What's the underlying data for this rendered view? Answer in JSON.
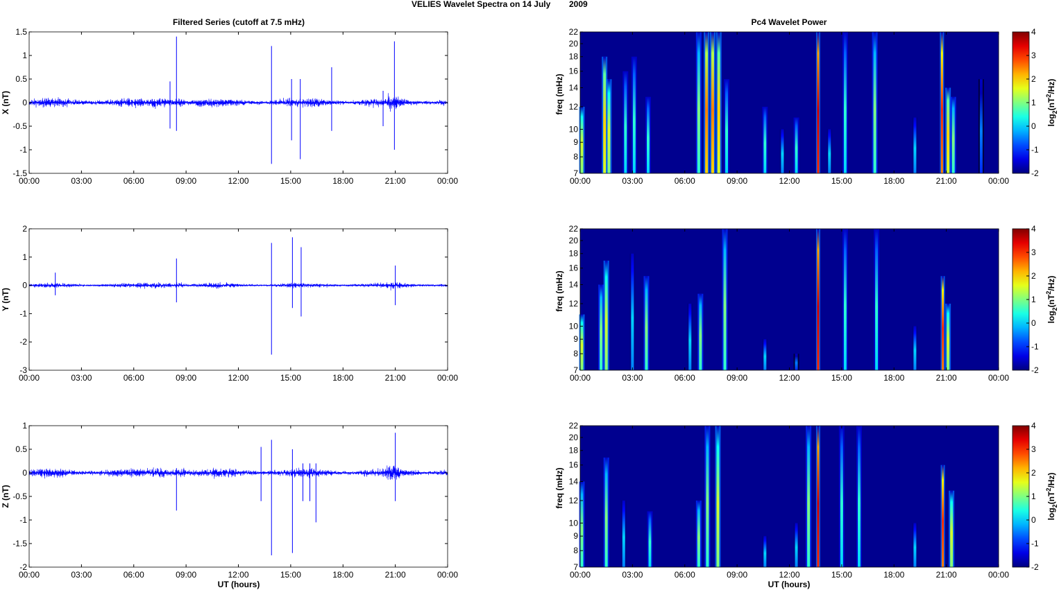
{
  "title": "VELIES Wavelet Spectra on 14 July",
  "year": "2009",
  "left_title": "Filtered Series (cutoff at 7.5 mHz)",
  "right_title": "Pc4 Wavelet Power",
  "xlabel": "UT (hours)",
  "freq_label": "freq (mHz)",
  "colorbar_label": "log2(nT2/Hz)",
  "colors": {
    "trace": "#0000ff",
    "background_power": "#00008f"
  },
  "chart_data": [
    {
      "type": "line",
      "name": "X",
      "ylabel": "X (nT)",
      "ylim": [
        -1.5,
        1.5
      ],
      "yticks": [
        "-1.5",
        "-1",
        "-0.5",
        "0",
        "0.5",
        "1",
        "1.5"
      ],
      "ytick_values": [
        -1.5,
        -1,
        -0.5,
        0,
        0.5,
        1,
        1.5
      ],
      "xticks": [
        "00:00",
        "03:00",
        "06:00",
        "09:00",
        "12:00",
        "15:00",
        "18:00",
        "21:00",
        "00:00"
      ],
      "xlim_hours": [
        0,
        24
      ],
      "noise_amplitude_nT": 0.15,
      "spikes": [
        {
          "t": 8.08,
          "max": 0.45,
          "min": -0.55
        },
        {
          "t": 8.45,
          "max": 1.4,
          "min": -0.6
        },
        {
          "t": 13.9,
          "max": 1.2,
          "min": -1.3
        },
        {
          "t": 15.05,
          "max": 0.5,
          "min": -0.8
        },
        {
          "t": 15.55,
          "max": 0.5,
          "min": -1.2
        },
        {
          "t": 17.35,
          "max": 0.75,
          "min": -0.6
        },
        {
          "t": 20.3,
          "max": 0.25,
          "min": -0.5
        },
        {
          "t": 20.95,
          "max": 1.3,
          "min": -1.0
        }
      ]
    },
    {
      "type": "line",
      "name": "Y",
      "ylabel": "Y (nT)",
      "ylim": [
        -3,
        2
      ],
      "yticks": [
        "-3",
        "-2",
        "-1",
        "0",
        "1",
        "2"
      ],
      "ytick_values": [
        -3,
        -2,
        -1,
        0,
        1,
        2
      ],
      "xticks": [
        "00:00",
        "03:00",
        "06:00",
        "09:00",
        "12:00",
        "15:00",
        "18:00",
        "21:00",
        "00:00"
      ],
      "xlim_hours": [
        0,
        24
      ],
      "noise_amplitude_nT": 0.14,
      "spikes": [
        {
          "t": 1.5,
          "max": 0.45,
          "min": -0.35
        },
        {
          "t": 8.45,
          "max": 0.95,
          "min": -0.6
        },
        {
          "t": 13.9,
          "max": 1.5,
          "min": -2.45
        },
        {
          "t": 15.1,
          "max": 1.7,
          "min": -0.8
        },
        {
          "t": 15.6,
          "max": 1.35,
          "min": -1.1
        },
        {
          "t": 21.0,
          "max": 0.7,
          "min": -0.7
        }
      ]
    },
    {
      "type": "line",
      "name": "Z",
      "ylabel": "Z (nT)",
      "ylim": [
        -2,
        1
      ],
      "yticks": [
        "-2",
        "-1.5",
        "-1",
        "-0.5",
        "0",
        "0.5",
        "1"
      ],
      "ytick_values": [
        -2,
        -1.5,
        -1,
        -0.5,
        0,
        0.5,
        1
      ],
      "xticks": [
        "00:00",
        "03:00",
        "06:00",
        "09:00",
        "12:00",
        "15:00",
        "18:00",
        "21:00",
        "00:00"
      ],
      "xlim_hours": [
        0,
        24
      ],
      "noise_amplitude_nT": 0.15,
      "spikes": [
        {
          "t": 8.45,
          "max": 0.1,
          "min": -0.8
        },
        {
          "t": 13.3,
          "max": 0.55,
          "min": -0.6
        },
        {
          "t": 13.9,
          "max": 0.7,
          "min": -1.75
        },
        {
          "t": 15.1,
          "max": 0.5,
          "min": -1.7
        },
        {
          "t": 15.7,
          "max": 0.2,
          "min": -0.6
        },
        {
          "t": 16.1,
          "max": 0.2,
          "min": -0.6
        },
        {
          "t": 16.45,
          "max": 0.2,
          "min": -1.05
        },
        {
          "t": 21.0,
          "max": 0.85,
          "min": -0.6
        }
      ]
    },
    {
      "type": "heatmap",
      "name": "X power",
      "ylabel": "freq (mHz)",
      "yscale": "log",
      "ylim": [
        7,
        22
      ],
      "yticks": [
        "7",
        "8",
        "9",
        "10",
        "12",
        "14",
        "16",
        "18",
        "20",
        "22"
      ],
      "ytick_values": [
        7,
        8,
        9,
        10,
        12,
        14,
        16,
        18,
        20,
        22
      ],
      "xticks": [
        "00:00",
        "03:00",
        "06:00",
        "09:00",
        "12:00",
        "15:00",
        "18:00",
        "21:00",
        "00:00"
      ],
      "clim": [
        -2,
        4
      ],
      "cticks": [
        "-2",
        "-1",
        "0",
        "1",
        "2",
        "3",
        "4"
      ],
      "bursts": [
        [
          0.1,
          12,
          1.5
        ],
        [
          1.4,
          18,
          2
        ],
        [
          1.65,
          15,
          1.5
        ],
        [
          2.6,
          16,
          0.5
        ],
        [
          3.1,
          18,
          0.5
        ],
        [
          3.9,
          13,
          0.5
        ],
        [
          6.8,
          22,
          1
        ],
        [
          7.25,
          22,
          2.5
        ],
        [
          7.6,
          22,
          2.5
        ],
        [
          7.95,
          22,
          2
        ],
        [
          8.4,
          15,
          0.5
        ],
        [
          10.6,
          12,
          0.5
        ],
        [
          11.6,
          10,
          0
        ],
        [
          12.4,
          11,
          0.5
        ],
        [
          13.65,
          22,
          3.5
        ],
        [
          14.3,
          10,
          0
        ],
        [
          15.2,
          22,
          0.5
        ],
        [
          16.9,
          22,
          1
        ],
        [
          19.2,
          11,
          0
        ],
        [
          20.75,
          22,
          3
        ],
        [
          21.1,
          14,
          2
        ],
        [
          21.4,
          13,
          1
        ],
        [
          23.0,
          15,
          -0.5
        ]
      ]
    },
    {
      "type": "heatmap",
      "name": "Y power",
      "ylabel": "freq (mHz)",
      "yscale": "log",
      "ylim": [
        7,
        22
      ],
      "yticks": [
        "7",
        "8",
        "9",
        "10",
        "12",
        "14",
        "16",
        "18",
        "20",
        "22"
      ],
      "ytick_values": [
        7,
        8,
        9,
        10,
        12,
        14,
        16,
        18,
        20,
        22
      ],
      "xticks": [
        "00:00",
        "03:00",
        "06:00",
        "09:00",
        "12:00",
        "15:00",
        "18:00",
        "21:00",
        "00:00"
      ],
      "clim": [
        -2,
        4
      ],
      "cticks": [
        "-2",
        "-1",
        "0",
        "1",
        "2",
        "3",
        "4"
      ],
      "bursts": [
        [
          0.1,
          11,
          1.5
        ],
        [
          1.2,
          14,
          1
        ],
        [
          1.5,
          17,
          1.5
        ],
        [
          3.0,
          18,
          0
        ],
        [
          3.8,
          15,
          1
        ],
        [
          6.3,
          12,
          0
        ],
        [
          6.9,
          13,
          1
        ],
        [
          8.3,
          22,
          1
        ],
        [
          10.6,
          9,
          0
        ],
        [
          12.4,
          8,
          -0.5
        ],
        [
          13.65,
          22,
          3.5
        ],
        [
          15.2,
          22,
          0.5
        ],
        [
          17.0,
          22,
          0.5
        ],
        [
          19.2,
          10,
          0
        ],
        [
          20.8,
          15,
          3
        ],
        [
          21.1,
          12,
          1.5
        ]
      ]
    },
    {
      "type": "heatmap",
      "name": "Z power",
      "ylabel": "freq (mHz)",
      "yscale": "log",
      "ylim": [
        7,
        22
      ],
      "yticks": [
        "7",
        "8",
        "9",
        "10",
        "12",
        "14",
        "16",
        "18",
        "20",
        "22"
      ],
      "ytick_values": [
        7,
        8,
        9,
        10,
        12,
        14,
        16,
        18,
        20,
        22
      ],
      "xticks": [
        "00:00",
        "03:00",
        "06:00",
        "09:00",
        "12:00",
        "15:00",
        "18:00",
        "21:00",
        "00:00"
      ],
      "clim": [
        -2,
        4
      ],
      "cticks": [
        "-2",
        "-1",
        "0",
        "1",
        "2",
        "3",
        "4"
      ],
      "bursts": [
        [
          0.1,
          14,
          1
        ],
        [
          1.5,
          17,
          1
        ],
        [
          2.5,
          12,
          0
        ],
        [
          4.0,
          11,
          0.5
        ],
        [
          6.8,
          12,
          1
        ],
        [
          7.3,
          22,
          1
        ],
        [
          7.9,
          22,
          1.5
        ],
        [
          10.6,
          9,
          0
        ],
        [
          12.4,
          10,
          0
        ],
        [
          13.1,
          22,
          1
        ],
        [
          13.65,
          22,
          3.5
        ],
        [
          15.0,
          22,
          0.5
        ],
        [
          16.0,
          22,
          0.5
        ],
        [
          19.2,
          10,
          0
        ],
        [
          20.8,
          16,
          3
        ],
        [
          21.3,
          13,
          1.5
        ]
      ]
    }
  ]
}
